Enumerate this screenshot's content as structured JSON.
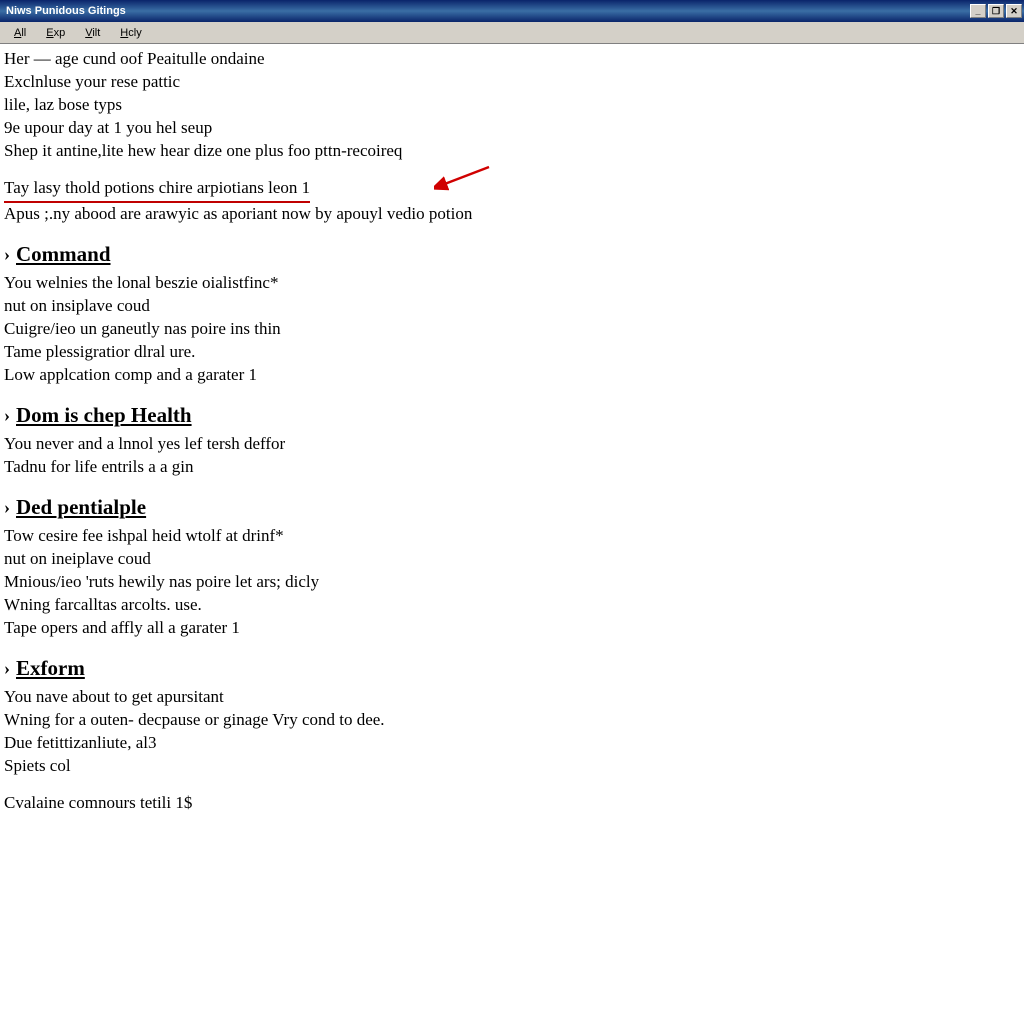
{
  "window": {
    "title": "Niws Punidous Gitings",
    "buttons": {
      "min": "_",
      "max": "❐",
      "close": "✕"
    }
  },
  "menu": {
    "items": [
      {
        "accel": "A",
        "rest": "ll"
      },
      {
        "accel": "E",
        "rest": "xp"
      },
      {
        "accel": "V",
        "rest": "ilt"
      },
      {
        "accel": "H",
        "rest": "cly"
      }
    ]
  },
  "intro": {
    "lines": [
      "Her — age cund oof Peaitulle ondaine",
      "Exclnluse your rese pattic",
      "lile, laz bose typs",
      "9e upour day at 1 you hel seup",
      "Shep it antine,lite hew hear dize one plus foo pttn-recoireq"
    ]
  },
  "highlight": {
    "line": "Tay lasy thold potions chire arpiotians leon 1",
    "after": "Apus ;.ny abood are arawyic as aporiant now by apouyl vedio potion"
  },
  "sections": [
    {
      "heading": "Command",
      "lines": [
        "You welnies the lonal beszie oialistfinc*",
        "nut on insiplave coud",
        "Cuigre/ieo un ganeutly nas poire ins thin",
        "Tame plessigratior dlral ure.",
        "Low applcation comp and a garater 1"
      ]
    },
    {
      "heading": "Dom is chep Health",
      "lines": [
        "You never and a lnnol yes lef tersh deffor",
        "Tadnu for life entrils a a gin"
      ]
    },
    {
      "heading": "Ded pentialple",
      "lines": [
        "Tow cesire fee ishpal heid wtolf at drinf*",
        "nut on ineiplave coud",
        "Mnious/ieo 'ruts hewily nas poire let ars; dicly",
        "Wning farcalltas arcolts. use.",
        "Tape opers and affly all a garater 1"
      ]
    },
    {
      "heading": "Exform",
      "lines": [
        "You nave about to get apursitant",
        "Wning for a outen- decpause or ginage Vry cond to dee.",
        "Due fetittizanliute, al3",
        "Spiets col"
      ],
      "trailing": "Cvalaine comnours tetili 1$"
    }
  ]
}
